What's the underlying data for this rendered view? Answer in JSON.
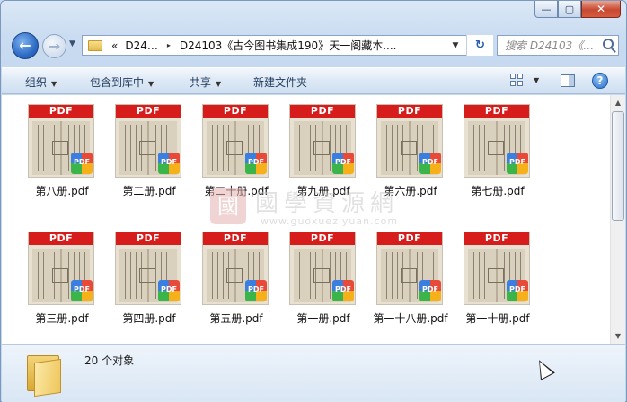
{
  "window": {
    "caption": {
      "minimize": "—",
      "maximize": "▢",
      "close": "✕"
    }
  },
  "nav": {
    "breadcrumb": [
      "«",
      "D24…",
      "▸",
      "D24103《古今图书集成190》天一阁藏本...."
    ],
    "search_placeholder": "搜索 D24103《…"
  },
  "toolbar": {
    "organize": "组织",
    "include_in_library": "包含到库中",
    "share": "共享",
    "new_folder": "新建文件夹"
  },
  "files": [
    {
      "name": "第八册.pdf"
    },
    {
      "name": "第二册.pdf"
    },
    {
      "name": "第二十册.pdf"
    },
    {
      "name": "第九册.pdf"
    },
    {
      "name": "第六册.pdf"
    },
    {
      "name": "第七册.pdf"
    },
    {
      "name": "第三册.pdf"
    },
    {
      "name": "第四册.pdf"
    },
    {
      "name": "第五册.pdf"
    },
    {
      "name": "第一册.pdf"
    },
    {
      "name": "第一十八册.pdf"
    },
    {
      "name": "第一十册.pdf"
    }
  ],
  "thumb_label": "PDF",
  "watermark": {
    "seal": "國",
    "text": "國學資源網",
    "url": "www.guoxueziyuan.com"
  },
  "details": {
    "count": "20 个对象"
  }
}
